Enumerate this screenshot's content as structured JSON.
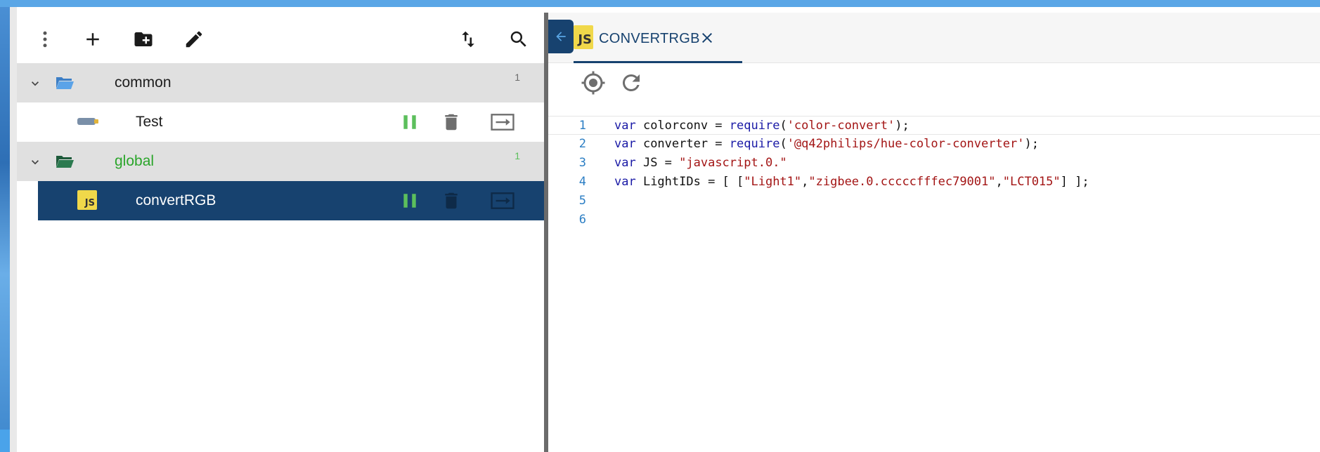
{
  "toolbar": {
    "menu_icon": "more-vert-icon",
    "add_icon": "add-icon",
    "new_folder_icon": "create-new-folder-icon",
    "edit_icon": "edit-icon",
    "sort_icon": "sort-arrows-icon",
    "search_icon": "search-icon"
  },
  "tree": {
    "rows": [
      {
        "type": "folder",
        "label": "common",
        "count": "1"
      },
      {
        "type": "script",
        "label": "Test",
        "icon": "blockly-icon"
      },
      {
        "type": "folder",
        "label": "global",
        "count": "1"
      },
      {
        "type": "script",
        "label": "convertRGB",
        "icon": "js-icon",
        "selected": true
      }
    ]
  },
  "editor": {
    "tab_label": "CONVERTRGB",
    "js_badge": "JS",
    "code_lines": [
      {
        "num": "1",
        "text": "var colorconv = require('color-convert');"
      },
      {
        "num": "2",
        "text": "var converter = require('@q42philips/hue-color-converter');"
      },
      {
        "num": "3",
        "text": "var JS = \"javascript.0.\""
      },
      {
        "num": "4",
        "text": "var LightIDs = [ [\"Light1\",\"zigbee.0.cccccfffec79001\",\"LCT015\"] ];"
      },
      {
        "num": "5",
        "text": ""
      },
      {
        "num": "6",
        "text": ""
      }
    ]
  },
  "colors": {
    "accent": "#17426f",
    "running_green": "#5cbf5c",
    "folder_green": "#2aa52a",
    "folder_blue": "#4a90d9"
  }
}
